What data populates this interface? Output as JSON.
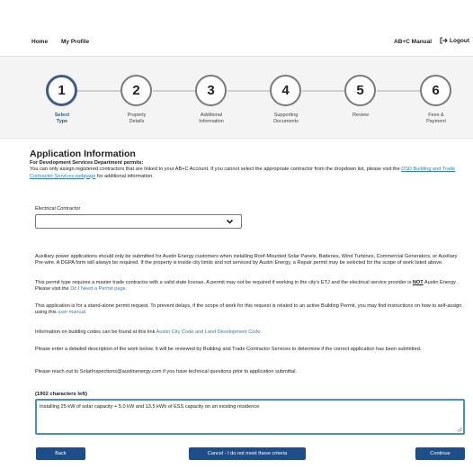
{
  "nav": {
    "home": "Home",
    "profile": "My Profile",
    "manual": "AB+C Manual",
    "logout": "Logout"
  },
  "steps": [
    {
      "num": "1",
      "label": "Select\nType",
      "active": true
    },
    {
      "num": "2",
      "label": "Property\nDetails",
      "active": false
    },
    {
      "num": "3",
      "label": "Additional\nInformation",
      "active": false
    },
    {
      "num": "4",
      "label": "Supporting\nDocuments",
      "active": false
    },
    {
      "num": "5",
      "label": "Review",
      "active": false
    },
    {
      "num": "6",
      "label": "Fees &\nPayment",
      "active": false
    }
  ],
  "form": {
    "title": "Application Information",
    "subtitle": "For Development Services Department permits:",
    "intro_1": "You can only assign registered contractors that are linked to your AB+C Account. If you cannot select the appropriate contractor from the dropdown list, please visit the ",
    "intro_link": "DSD Building and Trade Contractor Services webpage",
    "intro_2": " for additional information.",
    "contractor_label": "Electrical Contractor",
    "contractor_value": "",
    "p1": "Auxiliary power applications should only be submitted for Austin Energy customers when installing Roof-Mounted Solar Panels, Batteries, Wind Turbines, Commercial Generators, or Auxiliary Pre-wire. A DGPA form will always be required. If the property is inside city limits and not serviced by Austin Energy, a Repair permit may be selected for the scope of work listed above.",
    "p2a": "This permit type requires a master trade contractor with a valid state license. A permit may not be required if working in the city's ETJ and the electrical service provider is ",
    "p2_not": "NOT",
    "p2b": " Austin Energy . Please visit the ",
    "p2_link": "Do I Need a Permit page.",
    "p3a": "This application is for a stand-alone permit request. To prevent delays, if the scope of work for this request is related to an active Building Permit, you may find instructions on how to self-assign using this ",
    "p3_link": "user manual.",
    "p4a": "Information on building codes can be found at this link ",
    "p4_link": "Austin City Code and Land Development Code.",
    "p5": "Please enter a detailed description of the work below. It will be reviewed by Building and Trade Contractor Services to determine if the correct application has been submitted.",
    "p6": "Please reach out to SolarInspections@austinenergy.com if you have technical questions prior to application submittal.",
    "chars_left": "(1902 characters left)",
    "description": "Installing 25 kW of solar capacity + 5.0 kW and 13.5 kWh of ESS capacity on an existing residence."
  },
  "buttons": {
    "back": "Back",
    "cancel": "Cancel - I do not meet these criteria",
    "continue": "Continue"
  },
  "colors": {
    "primary": "#1d4e8a",
    "link": "#2f7fc6",
    "focus": "#4a8ec9"
  }
}
